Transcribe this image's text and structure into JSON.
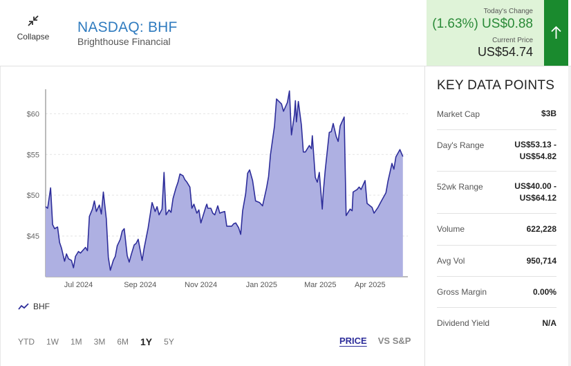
{
  "header": {
    "collapse_label": "Collapse",
    "ticker": "NASDAQ: BHF",
    "company": "Brighthouse Financial"
  },
  "quote": {
    "change_label": "Today's Change",
    "change_value": "(1.63%) US$0.88",
    "price_label": "Current Price",
    "price_value": "US$54.74",
    "direction": "up"
  },
  "colors": {
    "accent": "#2f7bbf",
    "positive": "#2a8a38",
    "positive_bg": "#dff3d8",
    "arrow_bg": "#1a8a2e",
    "series_line": "#2d2d9a",
    "series_fill": "#aeb0e2"
  },
  "chart_data": {
    "type": "area",
    "series": [
      {
        "name": "BHF",
        "dates": [
          "2024-05-29",
          "2024-05-31",
          "2024-06-03",
          "2024-06-05",
          "2024-06-07",
          "2024-06-10",
          "2024-06-12",
          "2024-06-14",
          "2024-06-17",
          "2024-06-19",
          "2024-06-21",
          "2024-06-24",
          "2024-06-26",
          "2024-06-28",
          "2024-07-01",
          "2024-07-03",
          "2024-07-08",
          "2024-07-10",
          "2024-07-12",
          "2024-07-15",
          "2024-07-17",
          "2024-07-19",
          "2024-07-22",
          "2024-07-24",
          "2024-07-26",
          "2024-07-29",
          "2024-07-31",
          "2024-08-02",
          "2024-08-05",
          "2024-08-07",
          "2024-08-09",
          "2024-08-12",
          "2024-08-14",
          "2024-08-16",
          "2024-08-19",
          "2024-08-21",
          "2024-08-23",
          "2024-08-26",
          "2024-08-28",
          "2024-08-30",
          "2024-09-03",
          "2024-09-05",
          "2024-09-09",
          "2024-09-11",
          "2024-09-13",
          "2024-09-16",
          "2024-09-18",
          "2024-09-20",
          "2024-09-23",
          "2024-09-25",
          "2024-09-27",
          "2024-09-30",
          "2024-10-02",
          "2024-10-04",
          "2024-10-07",
          "2024-10-09",
          "2024-10-11",
          "2024-10-14",
          "2024-10-16",
          "2024-10-18",
          "2024-10-21",
          "2024-10-23",
          "2024-10-25",
          "2024-10-28",
          "2024-10-30",
          "2024-11-01",
          "2024-11-04",
          "2024-11-06",
          "2024-11-07",
          "2024-11-08",
          "2024-11-11",
          "2024-11-13",
          "2024-11-15",
          "2024-11-18",
          "2024-11-20",
          "2024-11-22",
          "2024-11-25",
          "2024-11-27",
          "2024-12-02",
          "2024-12-04",
          "2024-12-06",
          "2024-12-09",
          "2024-12-11",
          "2024-12-13",
          "2024-12-16",
          "2024-12-18",
          "2024-12-20",
          "2024-12-23",
          "2024-12-26",
          "2024-12-30",
          "2025-01-02",
          "2025-01-06",
          "2025-01-08",
          "2025-01-10",
          "2025-01-14",
          "2025-01-16",
          "2025-01-21",
          "2025-01-23",
          "2025-01-27",
          "2025-01-29",
          "2025-01-31",
          "2025-02-03",
          "2025-02-04",
          "2025-02-05",
          "2025-02-07",
          "2025-02-10",
          "2025-02-12",
          "2025-02-14",
          "2025-02-18",
          "2025-02-20",
          "2025-02-21",
          "2025-02-24",
          "2025-02-26",
          "2025-02-28",
          "2025-03-03",
          "2025-03-04",
          "2025-03-06",
          "2025-03-10",
          "2025-03-12",
          "2025-03-14",
          "2025-03-17",
          "2025-03-19",
          "2025-03-21",
          "2025-03-25",
          "2025-03-27",
          "2025-03-31",
          "2025-04-02",
          "2025-04-03",
          "2025-04-07",
          "2025-04-09",
          "2025-04-11",
          "2025-04-15",
          "2025-04-17",
          "2025-04-22",
          "2025-04-24",
          "2025-04-28",
          "2025-05-01",
          "2025-05-06",
          "2025-05-08",
          "2025-05-12",
          "2025-05-14",
          "2025-05-16",
          "2025-05-20",
          "2025-05-23",
          "2025-05-28"
        ],
        "values": [
          48.6,
          48.4,
          50.9,
          46.4,
          45.9,
          46.1,
          44.2,
          43.5,
          41.9,
          42.8,
          42.2,
          42.0,
          41.1,
          42.5,
          43.1,
          42.9,
          43.6,
          43.2,
          47.4,
          48.3,
          49.3,
          48.0,
          48.8,
          47.7,
          50.4,
          47.1,
          42.4,
          40.8,
          42.0,
          42.5,
          43.8,
          44.6,
          45.6,
          45.9,
          42.6,
          41.8,
          42.7,
          43.9,
          44.1,
          44.6,
          42.0,
          43.5,
          46.0,
          47.6,
          49.1,
          48.0,
          48.6,
          47.6,
          48.3,
          52.8,
          47.6,
          48.2,
          47.9,
          49.6,
          50.9,
          51.6,
          52.6,
          52.4,
          51.9,
          51.6,
          51.0,
          48.4,
          48.9,
          47.8,
          48.2,
          46.6,
          47.8,
          48.6,
          48.9,
          48.4,
          48.4,
          47.8,
          47.6,
          48.7,
          47.8,
          47.9,
          48.0,
          46.2,
          46.2,
          46.5,
          46.6,
          46.0,
          45.2,
          48.1,
          50.2,
          52.7,
          53.1,
          51.8,
          49.3,
          49.1,
          48.7,
          50.9,
          52.3,
          55.0,
          58.5,
          61.8,
          61.2,
          60.3,
          61.4,
          62.8,
          57.4,
          59.9,
          61.6,
          59.0,
          61.5,
          58.6,
          55.3,
          55.3,
          56.1,
          55.7,
          57.3,
          52.2,
          51.6,
          52.8,
          48.3,
          50.3,
          53.1,
          57.7,
          57.8,
          58.8,
          57.2,
          56.6,
          58.5,
          59.6,
          47.5,
          48.3,
          48.1,
          50.4,
          50.7,
          51.0,
          50.7,
          51.8,
          49.0,
          48.5,
          47.8,
          48.5,
          49.2,
          50.3,
          51.7,
          53.9,
          53.2,
          54.7,
          55.6,
          54.74
        ],
        "note": "traced from price line"
      }
    ],
    "x_ticks": [
      "Jul 2024",
      "Sep 2024",
      "Nov 2024",
      "Jan 2025",
      "Mar 2025",
      "Apr 2025"
    ],
    "y_ticks": [
      "$60",
      "$55",
      "$50",
      "$45"
    ],
    "y_tick_values": [
      60,
      55,
      50,
      45
    ],
    "ylim": [
      40.0,
      63.0
    ],
    "grid": "horizontal-dashed",
    "legend": "bottom-left"
  },
  "legend": {
    "label": "BHF"
  },
  "ranges": [
    {
      "label": "YTD",
      "active": false
    },
    {
      "label": "1W",
      "active": false
    },
    {
      "label": "1M",
      "active": false
    },
    {
      "label": "3M",
      "active": false
    },
    {
      "label": "6M",
      "active": false
    },
    {
      "label": "1Y",
      "active": true
    },
    {
      "label": "5Y",
      "active": false
    }
  ],
  "views": [
    {
      "label": "PRICE",
      "active": true
    },
    {
      "label": "VS S&P",
      "active": false
    }
  ],
  "key_data": {
    "title": "KEY DATA POINTS",
    "rows": [
      {
        "label": "Market Cap",
        "value": "$3B"
      },
      {
        "label": "Day's Range",
        "value": "US$53.13 -\nUS$54.82"
      },
      {
        "label": "52wk Range",
        "value": "US$40.00 -\nUS$64.12"
      },
      {
        "label": "Volume",
        "value": "622,228"
      },
      {
        "label": "Avg Vol",
        "value": "950,714"
      },
      {
        "label": "Gross Margin",
        "value": "0.00%"
      },
      {
        "label": "Dividend Yield",
        "value": "N/A"
      }
    ]
  }
}
